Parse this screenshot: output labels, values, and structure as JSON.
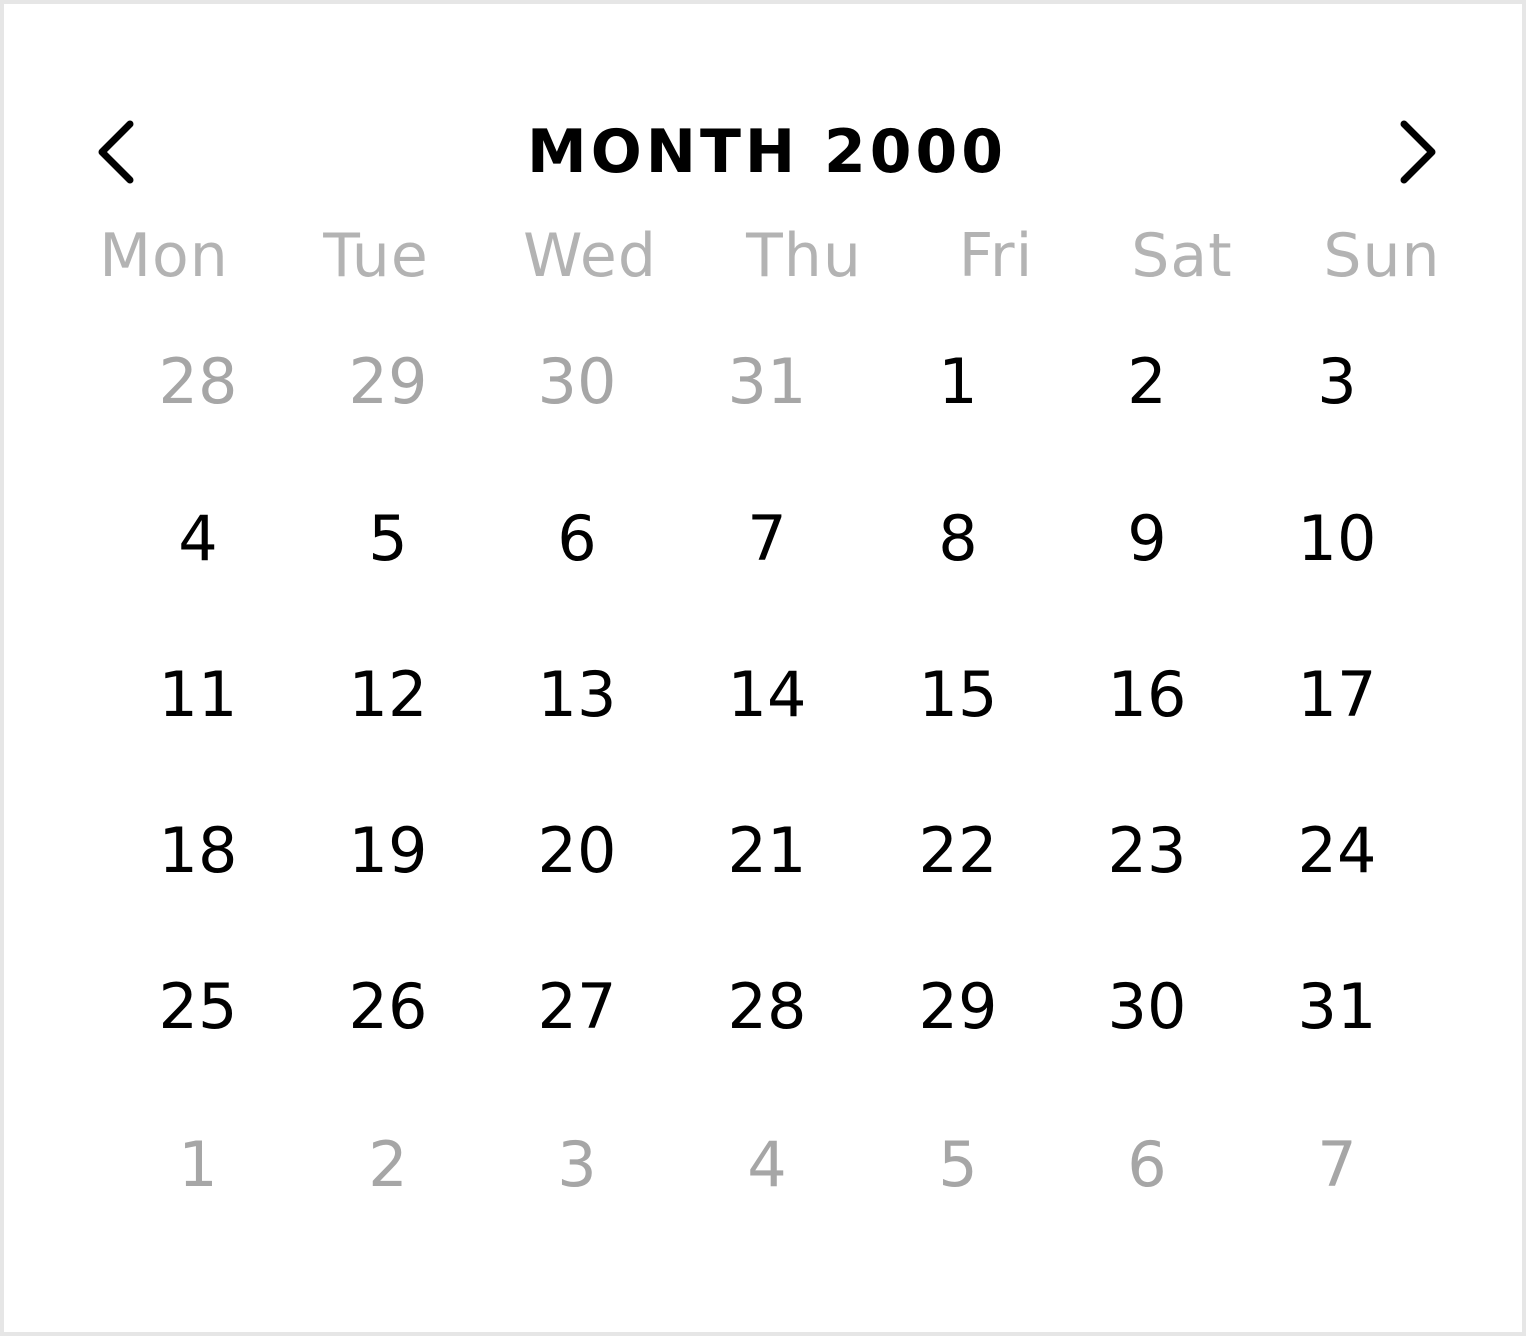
{
  "header": {
    "title": "MONTH 2000",
    "prev_icon": "chevron-left-icon",
    "next_icon": "chevron-right-icon"
  },
  "weekdays": [
    "Mon",
    "Tue",
    "Wed",
    "Thu",
    "Fri",
    "Sat",
    "Sun"
  ],
  "weeks": [
    [
      {
        "d": "28",
        "muted": true
      },
      {
        "d": "29",
        "muted": true
      },
      {
        "d": "30",
        "muted": true
      },
      {
        "d": "31",
        "muted": true
      },
      {
        "d": "1",
        "muted": false
      },
      {
        "d": "2",
        "muted": false
      },
      {
        "d": "3",
        "muted": false
      }
    ],
    [
      {
        "d": "4",
        "muted": false
      },
      {
        "d": "5",
        "muted": false
      },
      {
        "d": "6",
        "muted": false
      },
      {
        "d": "7",
        "muted": false
      },
      {
        "d": "8",
        "muted": false
      },
      {
        "d": "9",
        "muted": false
      },
      {
        "d": "10",
        "muted": false
      }
    ],
    [
      {
        "d": "11",
        "muted": false
      },
      {
        "d": "12",
        "muted": false
      },
      {
        "d": "13",
        "muted": false
      },
      {
        "d": "14",
        "muted": false
      },
      {
        "d": "15",
        "muted": false
      },
      {
        "d": "16",
        "muted": false
      },
      {
        "d": "17",
        "muted": false
      }
    ],
    [
      {
        "d": "18",
        "muted": false
      },
      {
        "d": "19",
        "muted": false
      },
      {
        "d": "20",
        "muted": false
      },
      {
        "d": "21",
        "muted": false
      },
      {
        "d": "22",
        "muted": false
      },
      {
        "d": "23",
        "muted": false
      },
      {
        "d": "24",
        "muted": false
      }
    ],
    [
      {
        "d": "25",
        "muted": false
      },
      {
        "d": "26",
        "muted": false
      },
      {
        "d": "27",
        "muted": false
      },
      {
        "d": "28",
        "muted": false
      },
      {
        "d": "29",
        "muted": false
      },
      {
        "d": "30",
        "muted": false
      },
      {
        "d": "31",
        "muted": false
      }
    ],
    [
      {
        "d": "1",
        "muted": true
      },
      {
        "d": "2",
        "muted": true
      },
      {
        "d": "3",
        "muted": true
      },
      {
        "d": "4",
        "muted": true
      },
      {
        "d": "5",
        "muted": true
      },
      {
        "d": "6",
        "muted": true
      },
      {
        "d": "7",
        "muted": true
      }
    ]
  ],
  "colors": {
    "current_month_day": "#000000",
    "other_month_day": "#a6a6a6",
    "weekday_label": "#b3b3b3",
    "frame_border": "#e6e6e6"
  }
}
